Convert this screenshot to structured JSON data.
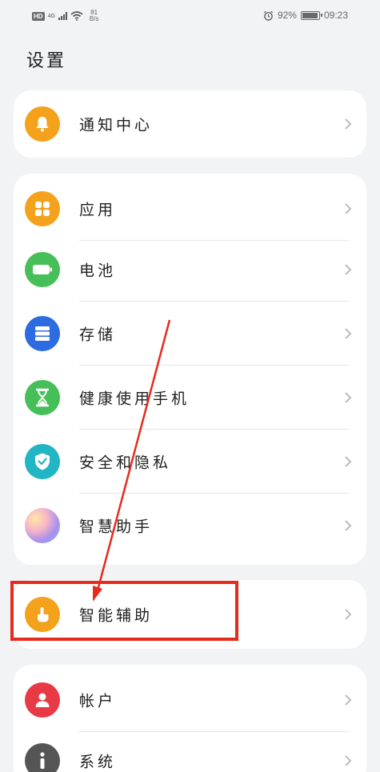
{
  "status_bar": {
    "hd_badge": "HD",
    "network": "4G",
    "speed_value": "81",
    "speed_unit": "B/s",
    "battery_percent": "92%",
    "time": "09:23"
  },
  "page": {
    "title": "设置"
  },
  "groups": [
    {
      "items": [
        {
          "label": "通知中心",
          "icon": "bell-icon",
          "color": "#f4a11c"
        }
      ]
    },
    {
      "items": [
        {
          "label": "应用",
          "icon": "apps-grid-icon",
          "color": "#f4a11c"
        },
        {
          "label": "电池",
          "icon": "battery-icon",
          "color": "#46bf58"
        },
        {
          "label": "存储",
          "icon": "storage-icon",
          "color": "#2c6be0"
        },
        {
          "label": "健康使用手机",
          "icon": "hourglass-icon",
          "color": "#46bf58"
        },
        {
          "label": "安全和隐私",
          "icon": "shield-check-icon",
          "color": "#22b5c4"
        },
        {
          "label": "智慧助手",
          "icon": "assistant-gradient-icon",
          "color": "#b98be8"
        }
      ]
    },
    {
      "items": [
        {
          "label": "智能辅助",
          "icon": "hand-tap-icon",
          "color": "#f4a11c"
        }
      ]
    },
    {
      "items": [
        {
          "label": "帐户",
          "icon": "account-icon",
          "color": "#e83a45"
        },
        {
          "label": "系统",
          "icon": "info-icon",
          "color": "#555555"
        }
      ]
    }
  ],
  "annotation": {
    "highlight_color": "#e62a1e"
  }
}
